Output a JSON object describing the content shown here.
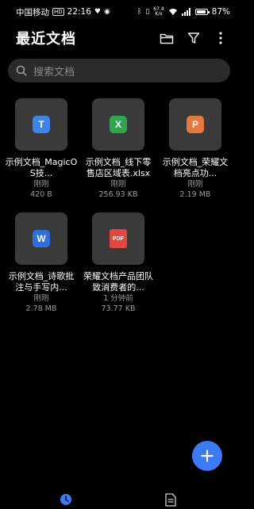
{
  "status_bar": {
    "carrier": "中国移动",
    "hd": "HD",
    "time": "22:16",
    "net_speed_value": "67.4",
    "net_speed_unit": "K/s",
    "battery": "87%"
  },
  "header": {
    "title": "最近文档",
    "icons": [
      "folder-icon",
      "filter-icon",
      "more-vert-icon"
    ]
  },
  "search": {
    "placeholder": "搜索文档"
  },
  "files": [
    {
      "type_label": "T",
      "color": "#3d86e8",
      "name": "示例文档_MagicOS技...",
      "time": "刚刚",
      "size": "420 B"
    },
    {
      "type_label": "X",
      "color": "#2fa74f",
      "name": "示例文档_线下零售店区域表.xlsx",
      "time": "刚刚",
      "size": "256.93 KB"
    },
    {
      "type_label": "P",
      "color": "#e5783a",
      "name": "示例文档_荣耀文档亮点功...",
      "time": "刚刚",
      "size": "2.19 MB"
    },
    {
      "type_label": "W",
      "color": "#2f6ee0",
      "name": "示例文档_诗歌批注与手写内...",
      "time": "刚刚",
      "size": "2.78 MB"
    },
    {
      "type_label": "PDF",
      "color": "#e2463f",
      "name": "荣耀文档产品团队致消费者的...",
      "time": "1 分钟前",
      "size": "73.77 KB"
    }
  ],
  "fab_icon": "plus-icon",
  "bottom_nav": [
    "recent-clock-icon",
    "documents-icon"
  ],
  "colors": {
    "accent": "#3d7af5",
    "background": "#000000",
    "card": "#3a3a3a"
  }
}
